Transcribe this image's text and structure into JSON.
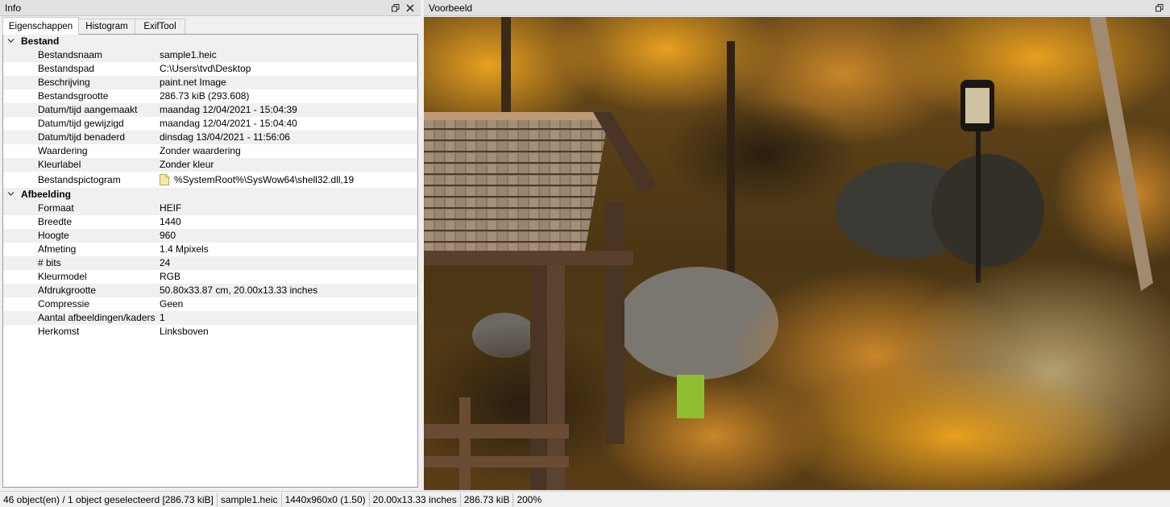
{
  "info_panel": {
    "title": "Info",
    "restore_icon": "restore-window-icon",
    "close_icon": "close-icon"
  },
  "preview_panel": {
    "title": "Voorbeeld",
    "restore_icon": "restore-window-icon"
  },
  "tabs": [
    {
      "label": "Eigenschappen",
      "active": true
    },
    {
      "label": "Histogram",
      "active": false
    },
    {
      "label": "ExifTool",
      "active": false
    }
  ],
  "groups": {
    "bestand": {
      "label": "Bestand",
      "rows": [
        {
          "key": "Bestandsnaam",
          "value": "sample1.heic"
        },
        {
          "key": "Bestandspad",
          "value": "C:\\Users\\tvd\\Desktop"
        },
        {
          "key": "Beschrijving",
          "value": "paint.net Image"
        },
        {
          "key": "Bestandsgrootte",
          "value": "286.73 kiB (293.608)"
        },
        {
          "key": "Datum/tijd aangemaakt",
          "value": "maandag 12/04/2021 - 15:04:39"
        },
        {
          "key": "Datum/tijd gewijzigd",
          "value": "maandag 12/04/2021 - 15:04:40"
        },
        {
          "key": "Datum/tijd benaderd",
          "value": "dinsdag 13/04/2021 - 11:56:06"
        },
        {
          "key": "Waardering",
          "value": "Zonder waardering"
        },
        {
          "key": "Kleurlabel",
          "value": "Zonder kleur"
        },
        {
          "key": "Bestandspictogram",
          "value": "%SystemRoot%\\SysWow64\\shell32.dll,19"
        }
      ]
    },
    "afbeelding": {
      "label": "Afbeelding",
      "rows": [
        {
          "key": "Formaat",
          "value": "HEIF"
        },
        {
          "key": "Breedte",
          "value": "1440"
        },
        {
          "key": "Hoogte",
          "value": "960"
        },
        {
          "key": "Afmeting",
          "value": "1.4 Mpixels"
        },
        {
          "key": "# bits",
          "value": "24"
        },
        {
          "key": "Kleurmodel",
          "value": "RGB"
        },
        {
          "key": "Afdrukgrootte",
          "value": "50.80x33.87 cm, 20.00x13.33 inches"
        },
        {
          "key": "Compressie",
          "value": "Geen"
        },
        {
          "key": "Aantal afbeeldingen/kaders",
          "value": "1"
        },
        {
          "key": "Herkomst",
          "value": "Linksboven"
        }
      ]
    }
  },
  "statusbar": {
    "objects": "46 object(en) / 1 object geselecteerd [286.73 kiB]",
    "filename": "sample1.heic",
    "dimensions": "1440x960x0 (1.50)",
    "print_size": "20.00x13.33 inches",
    "filesize": "286.73 kiB",
    "zoom": "200%"
  }
}
